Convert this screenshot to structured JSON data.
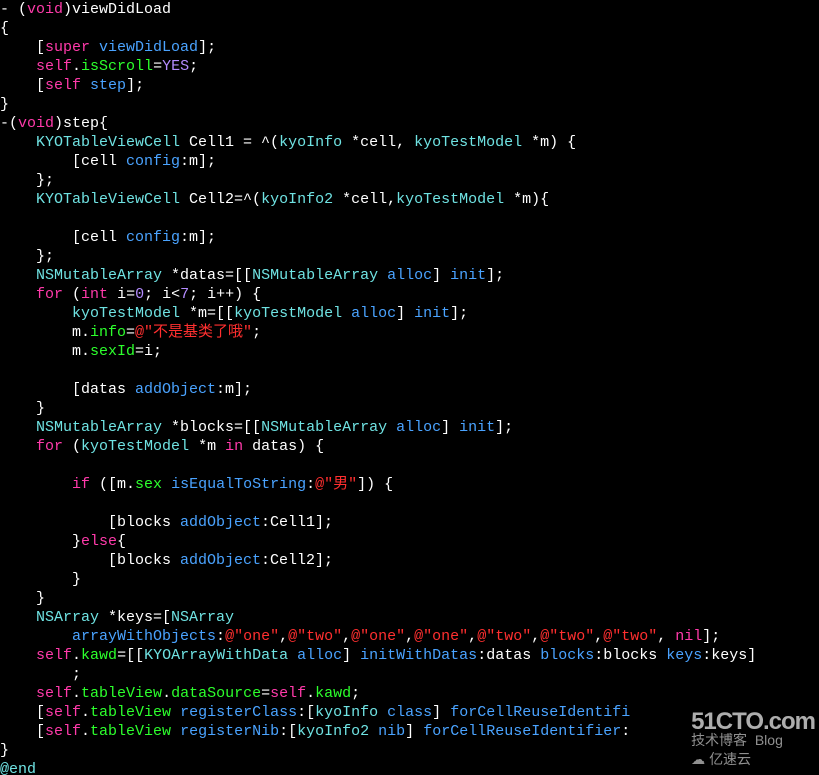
{
  "code": {
    "l1": {
      "t1": "- (",
      "kw": "void",
      "t2": ")viewDidLoad"
    },
    "l2": {
      "t": "{"
    },
    "l3": {
      "p": "    [",
      "sup": "super",
      "sp": " ",
      "m": "viewDidLoad",
      "t": "];"
    },
    "l4": {
      "p": "    ",
      "s": "self",
      "t1": ".",
      "mem": "isScroll",
      "t2": "=",
      "v": "YES",
      "t3": ";"
    },
    "l5": {
      "p": "    [",
      "s": "self",
      "sp": " ",
      "m": "step",
      "t": "];"
    },
    "l6": {
      "t": "}"
    },
    "l7": {
      "t1": "-(",
      "kw": "void",
      "t2": ")step{"
    },
    "l8": {
      "p": "    ",
      "ty": "KYOTableViewCell",
      "t1": " Cell1 = ^(",
      "ty2": "kyoInfo",
      "t2": " *cell, ",
      "ty3": "kyoTestModel",
      "t3": " *m) {"
    },
    "l9": {
      "p": "        [cell ",
      "m": "config",
      "t": ":m];"
    },
    "l10": {
      "t": "    };"
    },
    "l11": {
      "p": "    ",
      "ty": "KYOTableViewCell",
      "t1": " Cell2=^(",
      "ty2": "kyoInfo2",
      "t2": " *cell,",
      "ty3": "kyoTestModel",
      "t3": " *m){"
    },
    "l12": {
      "t": ""
    },
    "l13": {
      "p": "        [cell ",
      "m": "config",
      "t": ":m];"
    },
    "l14": {
      "t": "    };"
    },
    "l15": {
      "p": "    ",
      "ty": "NSMutableArray",
      "t1": " *datas=[[",
      "ty2": "NSMutableArray",
      "sp": " ",
      "m1": "alloc",
      "t2": "] ",
      "m2": "init",
      "t3": "];"
    },
    "l16": {
      "p": "    ",
      "kw": "for",
      "t1": " (",
      "kw2": "int",
      "t2": " i=",
      "n0": "0",
      "t3": "; i<",
      "n7": "7",
      "t4": "; i++) {"
    },
    "l17": {
      "p": "        ",
      "ty": "kyoTestModel",
      "t1": " *m=[[",
      "ty2": "kyoTestModel",
      "sp": " ",
      "m1": "alloc",
      "t2": "] ",
      "m2": "init",
      "t3": "];"
    },
    "l18": {
      "p": "        m.",
      "mem": "info",
      "t1": "=",
      "s": "@\"不是基类了哦\"",
      "t2": ";"
    },
    "l19": {
      "p": "        m.",
      "mem": "sexId",
      "t": "=i;"
    },
    "l20": {
      "t": ""
    },
    "l21": {
      "p": "        [datas ",
      "m": "addObject",
      "t": ":m];"
    },
    "l22": {
      "t": "    }"
    },
    "l23": {
      "p": "    ",
      "ty": "NSMutableArray",
      "t1": " *blocks=[[",
      "ty2": "NSMutableArray",
      "sp": " ",
      "m1": "alloc",
      "t2": "] ",
      "m2": "init",
      "t3": "];"
    },
    "l24": {
      "p": "    ",
      "kw": "for",
      "t1": " (",
      "ty": "kyoTestModel",
      "t2": " *m ",
      "kw2": "in",
      "t3": " datas) {"
    },
    "l25": {
      "t": ""
    },
    "l26": {
      "p": "        ",
      "kw": "if",
      "t1": " ([m.",
      "mem": "sex",
      "sp": " ",
      "m": "isEqualToString",
      "t2": ":",
      "s": "@\"男\"",
      "t3": "]) {"
    },
    "l27": {
      "t": ""
    },
    "l28": {
      "p": "            [blocks ",
      "m": "addObject",
      "t": ":Cell1];"
    },
    "l29": {
      "p": "        }",
      "kw": "else",
      "t": "{"
    },
    "l30": {
      "p": "            [blocks ",
      "m": "addObject",
      "t": ":Cell2];"
    },
    "l31": {
      "t": "        }"
    },
    "l32": {
      "t": "    }"
    },
    "l33": {
      "p": "    ",
      "ty": "NSArray",
      "t1": " *keys=[",
      "ty2": "NSArray"
    },
    "l34": {
      "p": "        ",
      "m": "arrayWithObjects",
      "t1": ":",
      "s1": "@\"one\"",
      "c1": ",",
      "s2": "@\"two\"",
      "c2": ",",
      "s3": "@\"one\"",
      "c3": ",",
      "s4": "@\"one\"",
      "c4": ",",
      "s5": "@\"two\"",
      "c5": ",",
      "s6": "@\"two\"",
      "c6": ",",
      "s7": "@\"two\"",
      "c7": ", ",
      "kw": "nil",
      "t2": "];"
    },
    "l35": {
      "p": "    ",
      "s": "self",
      "t1": ".",
      "mem": "kawd",
      "t2": "=[[",
      "ty": "KYOArrayWithData",
      "sp": " ",
      "m1": "alloc",
      "t3": "] ",
      "m2": "initWithDatas",
      "t4": ":datas ",
      "m3": "blocks",
      "t5": ":blocks ",
      "m4": "keys",
      "t6": ":keys]"
    },
    "l36": {
      "t": "        ;"
    },
    "l37": {
      "p": "    ",
      "s1": "self",
      "t1": ".",
      "mem1": "tableView",
      "t2": ".",
      "mem2": "dataSource",
      "t3": "=",
      "s2": "self",
      "t4": ".",
      "mem3": "kawd",
      "t5": ";"
    },
    "l38": {
      "p": "    [",
      "s": "self",
      "t1": ".",
      "mem": "tableView",
      "sp": " ",
      "m1": "registerClass",
      "t2": ":[",
      "ty": "kyoInfo",
      "sp2": " ",
      "m2": "class",
      "t3": "] ",
      "m3": "forCellReuseIdentifi"
    },
    "l39": {
      "p": "    [",
      "s": "self",
      "t1": ".",
      "mem": "tableView",
      "sp": " ",
      "m1": "registerNib",
      "t2": ":[",
      "ty": "kyoInfo2",
      "sp2": " ",
      "m2": "nib",
      "t3": "] ",
      "m3": "forCellReuseIdentifier",
      "t4": ":"
    },
    "l40": {
      "t": "}"
    },
    "l41": {
      "t": "@end"
    }
  },
  "watermark": {
    "brand": "51CTO.com",
    "tag1": "技术博客",
    "tag2": "Blog",
    "tag3": "亿速云"
  }
}
